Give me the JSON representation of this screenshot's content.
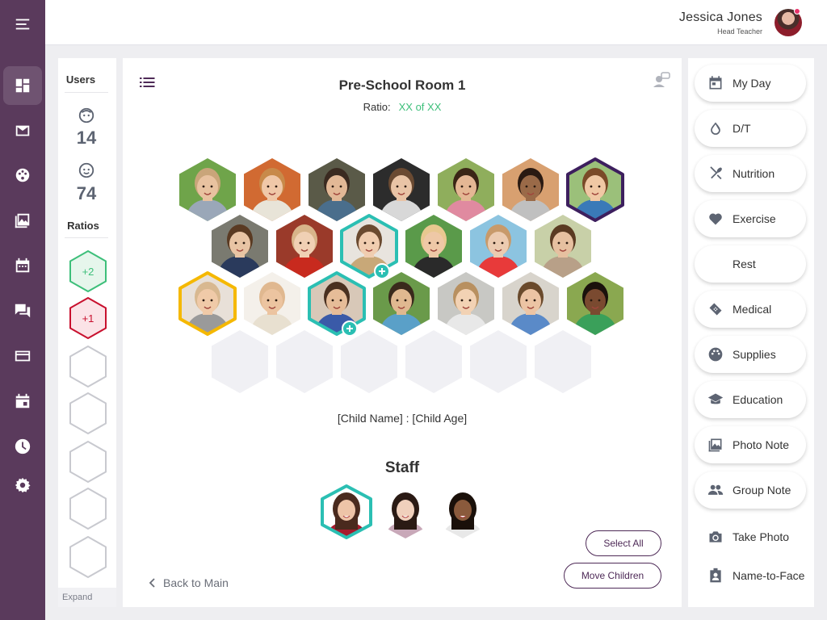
{
  "header": {
    "user_name": "Jessica Jones",
    "user_role": "Head Teacher",
    "notification_color": "#e8336a"
  },
  "nav": {
    "items": [
      {
        "icon": "menu-icon"
      },
      {
        "icon": "dashboard-icon",
        "active": true
      },
      {
        "icon": "mail-icon"
      },
      {
        "icon": "palette-icon"
      },
      {
        "icon": "photo-icon"
      },
      {
        "icon": "calendar-icon"
      },
      {
        "icon": "chat-icon"
      },
      {
        "icon": "card-icon"
      },
      {
        "icon": "event-icon"
      },
      {
        "icon": "clock-icon"
      },
      {
        "icon": "settings-icon"
      }
    ],
    "bg_color": "#5a3a5c"
  },
  "users": {
    "title": "Users",
    "children_count": "14",
    "infants_count": "74",
    "ratios_title": "Ratios",
    "ratio_badges": [
      {
        "label": "+2",
        "color": "#3dbf7a",
        "fill": "#e6f6ec"
      },
      {
        "label": "+1",
        "color": "#c8102e",
        "fill": "#fbe3e7"
      }
    ],
    "empty_slots": 5,
    "expand_label": "Expand"
  },
  "room": {
    "title": "Pre-School Room 1",
    "ratio_label": "Ratio:",
    "ratio_value": "XX of XX",
    "child_label": "[Child Name] : [Child Age]",
    "staff_title": "Staff",
    "select_all": "Select All",
    "move_children": "Move Children",
    "back_label": "Back to Main"
  },
  "children_rows": [
    [
      {
        "photo": "child-photo",
        "skin": "#e8c2a0",
        "hair": "#c9a57a",
        "bg": "#6fa44a",
        "shirt": "#9aa7b8"
      },
      {
        "photo": "child-photo",
        "skin": "#f0c8a8",
        "hair": "#c88a4a",
        "bg": "#d16a32",
        "shirt": "#e8e4d8"
      },
      {
        "photo": "child-photo",
        "skin": "#e2b896",
        "hair": "#3a2a20",
        "bg": "#5a5a48",
        "shirt": "#4a6e8c"
      },
      {
        "photo": "child-photo",
        "skin": "#e9c4a6",
        "hair": "#6a4a32",
        "bg": "#2c2c2c",
        "shirt": "#d8d8d8"
      },
      {
        "photo": "child-photo",
        "skin": "#e4b794",
        "hair": "#3a2616",
        "bg": "#8fae5c",
        "shirt": "#e08aa0"
      },
      {
        "photo": "child-photo",
        "skin": "#9a6a48",
        "hair": "#2a1a12",
        "bg": "#d8a070",
        "shirt": "#c0c0c0"
      },
      {
        "photo": "child-photo",
        "skin": "#f0c8a4",
        "hair": "#7a4a28",
        "bg": "#9bc07a",
        "shirt": "#3a7ab8",
        "ring": "#3d1f5e"
      }
    ],
    [
      {
        "photo": "child-photo",
        "skin": "#e8c4a4",
        "hair": "#5a3a22",
        "bg": "#7a7a70",
        "shirt": "#2a3a5c"
      },
      {
        "photo": "child-photo",
        "skin": "#f0d0b4",
        "hair": "#d8b48a",
        "bg": "#9a3a2a",
        "shirt": "#c82a1e"
      },
      {
        "photo": "child-photo",
        "skin": "#f0cdb0",
        "hair": "#6a4a30",
        "bg": "#e8e4de",
        "shirt": "#c8a878",
        "ring": "#2bbfb3",
        "plus": true
      },
      {
        "photo": "child-photo",
        "skin": "#eec8a6",
        "hair": "#e8c890",
        "bg": "#5a9a4a",
        "shirt": "#2a2a2a"
      },
      {
        "photo": "child-photo",
        "skin": "#eccbb0",
        "hair": "#c89a6a",
        "bg": "#8cc4e0",
        "shirt": "#e83a3a"
      },
      {
        "photo": "child-photo",
        "skin": "#e6c0a0",
        "hair": "#5a3a22",
        "bg": "#c8d0a8",
        "shirt": "#b8a088"
      }
    ],
    [
      {
        "photo": "child-photo",
        "skin": "#f0caa8",
        "hair": "#d8b890",
        "bg": "#e8e0d8",
        "shirt": "#9a9a9a",
        "ring": "#f5b800"
      },
      {
        "photo": "child-photo",
        "skin": "#ecc4a0",
        "hair": "#e0b890",
        "bg": "#f4f0ea",
        "shirt": "#e8e0d0"
      },
      {
        "photo": "child-photo",
        "skin": "#e6bc98",
        "hair": "#4a3020",
        "bg": "#d8c8b8",
        "shirt": "#3a5aa8",
        "ring": "#2bbfb3",
        "plus": true
      },
      {
        "photo": "child-photo",
        "skin": "#e0b890",
        "hair": "#3a2a1c",
        "bg": "#6a9a4a",
        "shirt": "#5aa0c8"
      },
      {
        "photo": "child-photo",
        "skin": "#f2d2b4",
        "hair": "#b89060",
        "bg": "#c8c8c4",
        "shirt": "#e8e8e8"
      },
      {
        "photo": "child-photo",
        "skin": "#ecc4a4",
        "hair": "#6a4a2c",
        "bg": "#d8d4cc",
        "shirt": "#5a8ac8"
      },
      {
        "photo": "child-photo",
        "skin": "#7a4a30",
        "hair": "#1a120c",
        "bg": "#8aa850",
        "shirt": "#3aa05a"
      }
    ]
  ],
  "empty_hex_count": 6,
  "staff": [
    {
      "photo": "staff-photo",
      "skin": "#eec4a8",
      "hair": "#4a2a1e",
      "bg": "#ffffff",
      "shirt": "#a81a2e",
      "ring": "#2bbfb3"
    },
    {
      "photo": "staff-photo",
      "skin": "#f0d0bc",
      "hair": "#2a1a14",
      "bg": "#ffffff",
      "shirt": "#c8a8b8"
    },
    {
      "photo": "staff-photo",
      "skin": "#8a5a3c",
      "hair": "#1a100a",
      "bg": "#ffffff",
      "shirt": "#e8e8e8"
    }
  ],
  "actions": [
    {
      "label": "My Day",
      "icon": "calendar-icon",
      "raised": true
    },
    {
      "label": "D/T",
      "icon": "drop-icon",
      "raised": true
    },
    {
      "label": "Nutrition",
      "icon": "utensils-icon",
      "raised": true
    },
    {
      "label": "Exercise",
      "icon": "heart-icon",
      "raised": true
    },
    {
      "label": "Rest",
      "icon": "moon-icon",
      "raised": true
    },
    {
      "label": "Medical",
      "icon": "bandage-icon",
      "raised": true
    },
    {
      "label": "Supplies",
      "icon": "palette-icon",
      "raised": true
    },
    {
      "label": "Education",
      "icon": "graduation-cap-icon",
      "raised": true
    },
    {
      "label": "Photo Note",
      "icon": "photo-icon",
      "raised": true
    },
    {
      "label": "Group Note",
      "icon": "group-icon",
      "raised": true
    },
    {
      "label": "Take Photo",
      "icon": "camera-icon",
      "raised": false
    },
    {
      "label": "Name-to-Face",
      "icon": "badge-icon",
      "raised": false
    }
  ]
}
